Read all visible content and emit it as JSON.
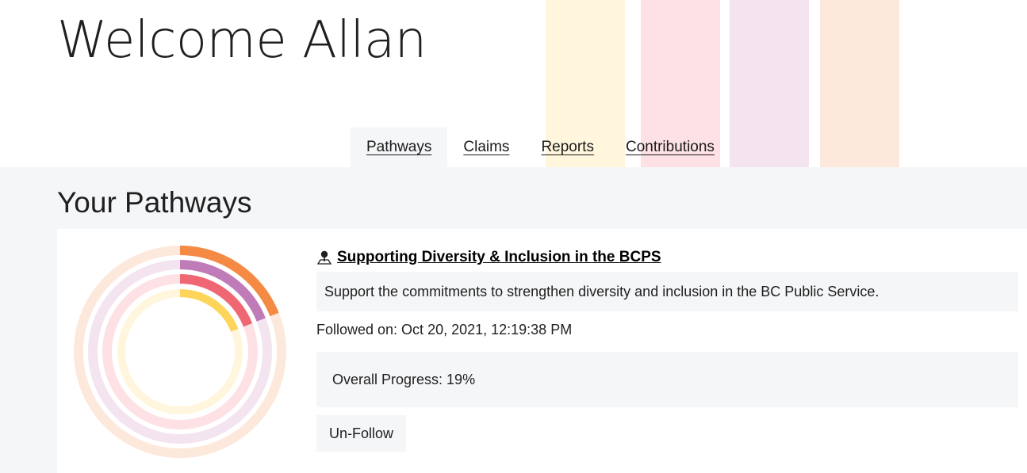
{
  "header": {
    "welcome": "Welcome Allan",
    "decor_colors": [
      "#fff6dd",
      "#fde1e4",
      "#f3e4f0",
      "#fde8dc"
    ]
  },
  "tabs": [
    {
      "label": "Pathways",
      "active": true
    },
    {
      "label": "Claims",
      "active": false
    },
    {
      "label": "Reports",
      "active": false
    },
    {
      "label": "Contributions",
      "active": false
    }
  ],
  "main": {
    "section_title": "Your Pathways"
  },
  "pathway": {
    "icon": "map-pin-person-icon",
    "title": "Supporting Diversity & Inclusion in the BCPS",
    "description": "Support the commitments to strengthen diversity and inclusion in the BC Public Service.",
    "followed_on": "Followed on: Oct 20, 2021, 12:19:38 PM",
    "overall_progress": "Overall Progress: 19%",
    "unfollow_label": "Un-Follow"
  },
  "progress_rings": [
    {
      "progress": 0.19,
      "color": "#f58a45",
      "track": "#fde8dc"
    },
    {
      "progress": 0.19,
      "color": "#c07cb8",
      "track": "#f3e4f0"
    },
    {
      "progress": 0.19,
      "color": "#ef6773",
      "track": "#fde1e4"
    },
    {
      "progress": 0.19,
      "color": "#fcd55a",
      "track": "#fff6dd"
    }
  ]
}
